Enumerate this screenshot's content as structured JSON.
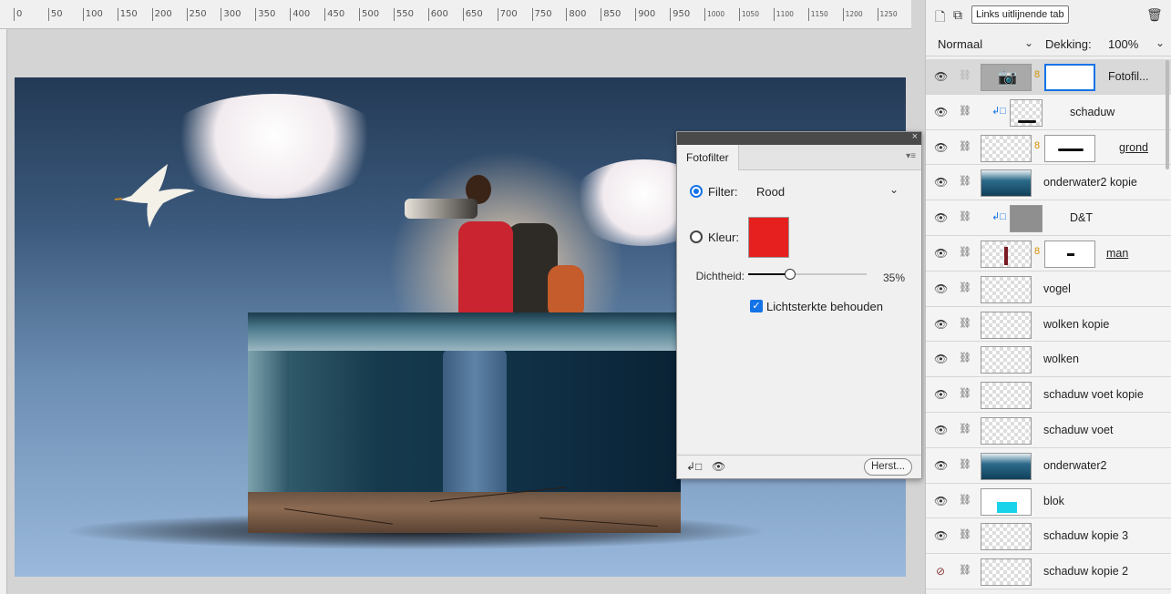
{
  "ruler": {
    "labels": [
      "0",
      "50",
      "100",
      "150",
      "200",
      "250",
      "300",
      "350",
      "400",
      "450",
      "500",
      "550",
      "600",
      "650",
      "700",
      "750",
      "800",
      "850",
      "900",
      "950",
      "1000",
      "1050",
      "1100",
      "1150",
      "1200",
      "1250"
    ]
  },
  "fotofilter": {
    "tab_label": "Fotofilter",
    "filter_label": "Filter:",
    "filter_value": "Rood",
    "color_label": "Kleur:",
    "color_value": "#e61f1f",
    "density_label": "Dichtheid:",
    "density_value": "35%",
    "density_fraction": 0.35,
    "preserve_luminosity_label": "Lichtsterkte behouden",
    "preserve_luminosity_checked": true,
    "reset_label": "Herst..."
  },
  "layers_panel": {
    "tooltip": "Links uitlijnende tab",
    "blend_mode": "Normaal",
    "opacity_label": "Dekking:",
    "opacity_value": "100%",
    "layers": [
      {
        "name": "Fotofil...",
        "visible": true
      },
      {
        "name": "schaduw",
        "visible": true
      },
      {
        "name": "grond",
        "visible": true
      },
      {
        "name": "onderwater2 kopie",
        "visible": true
      },
      {
        "name": "D&T",
        "visible": true
      },
      {
        "name": "man",
        "visible": true
      },
      {
        "name": "vogel",
        "visible": true
      },
      {
        "name": "wolken kopie",
        "visible": true
      },
      {
        "name": "wolken",
        "visible": true
      },
      {
        "name": "schaduw voet kopie",
        "visible": true
      },
      {
        "name": "schaduw voet",
        "visible": true
      },
      {
        "name": "onderwater2",
        "visible": true
      },
      {
        "name": "blok",
        "visible": true
      },
      {
        "name": "schaduw kopie 3",
        "visible": true
      },
      {
        "name": "schaduw kopie 2",
        "visible": false
      }
    ]
  },
  "colors": {
    "accent": "#1473e6",
    "filter_swatch": "#e61f1f",
    "chain_link": "#d49000"
  }
}
